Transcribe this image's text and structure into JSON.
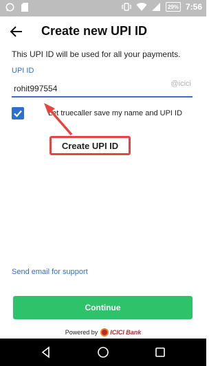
{
  "status_bar": {
    "time": "7:56",
    "battery": "29%",
    "icons": [
      "whatsapp-icon",
      "sd-card-icon",
      "vibrate-icon",
      "wifi-icon",
      "signal-icon",
      "battery-icon"
    ]
  },
  "app_bar": {
    "title": "Create new UPI ID",
    "back_icon": "arrow-left-icon"
  },
  "form": {
    "subtitle": "This UPI ID will be used for all your payments.",
    "upi_label": "UPI ID",
    "upi_value": "rohit997554",
    "upi_suffix": "@icici",
    "checkbox_checked": true,
    "checkbox_label": "Let truecaller save my name and UPI ID"
  },
  "annotation": {
    "text": "Create UPI ID",
    "color": "#e8433f"
  },
  "support_link": "Send email for support",
  "continue_label": "Continue",
  "footer": {
    "powered_by": "Powered by",
    "bank_name": "ICICI Bank"
  },
  "colors": {
    "accent": "#2f6fcf",
    "button": "#2ec36b",
    "status_bar": "#bdbdbd",
    "nav_bar": "#000000"
  },
  "nav": {
    "icons": [
      "back-triangle-icon",
      "home-circle-icon",
      "recents-square-icon"
    ]
  }
}
